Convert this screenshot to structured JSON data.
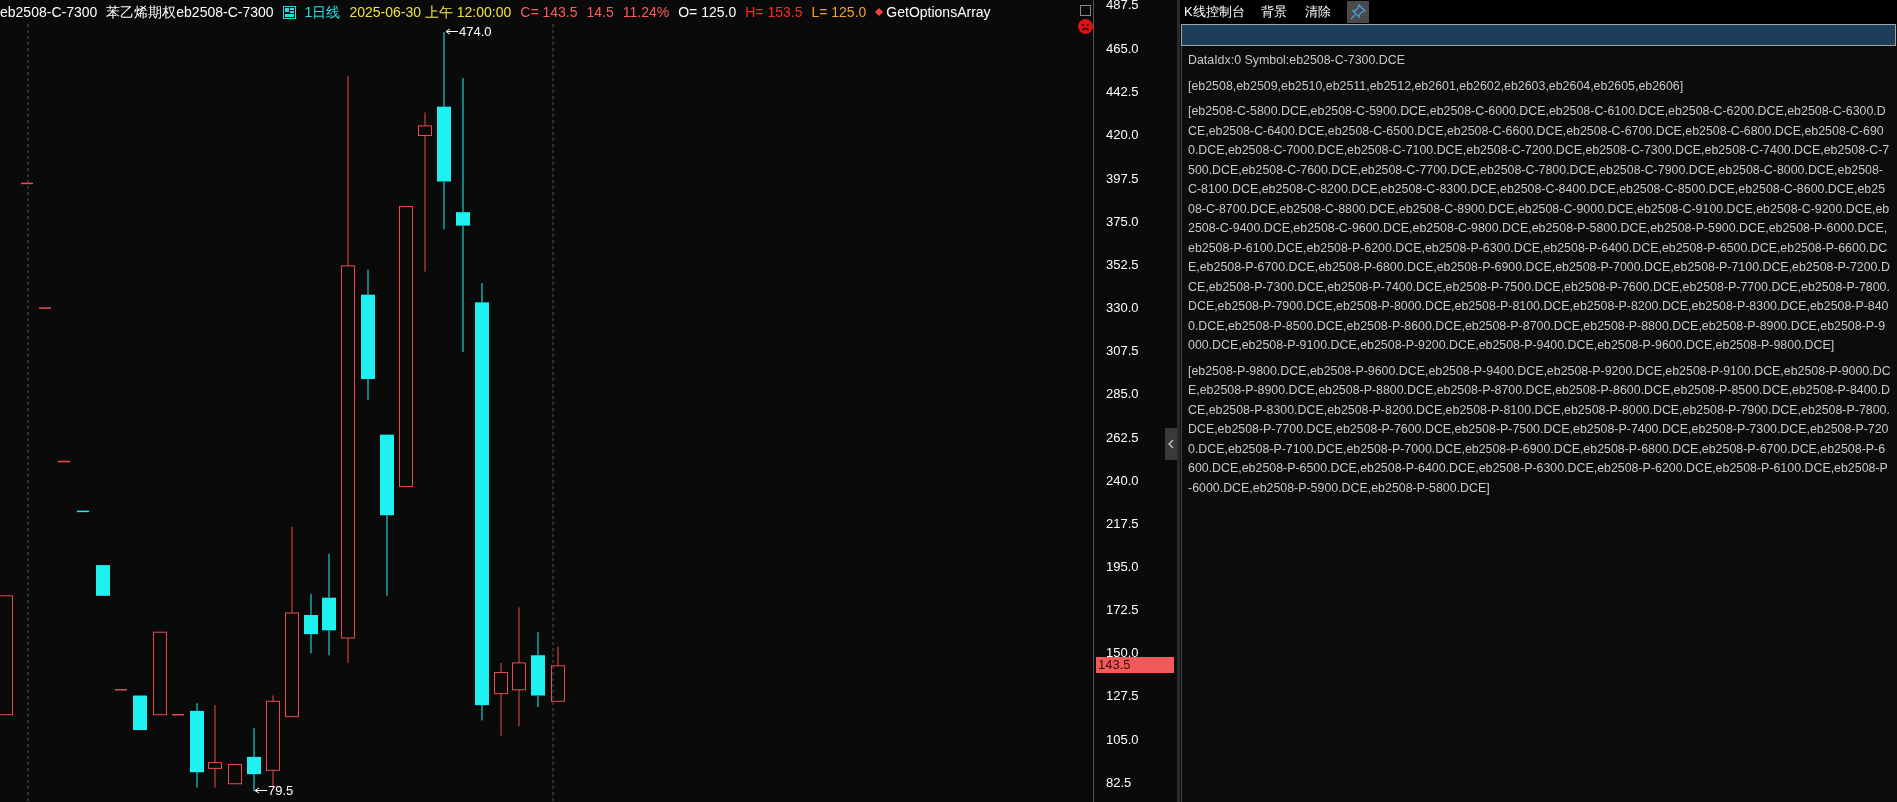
{
  "chart_header": [
    {
      "text": "eb2508-C-7300",
      "color": "#ffffff"
    },
    {
      "text": "苯乙烯期权eb2508-C-7300",
      "color": "#ffffff"
    },
    {
      "text": "1日线",
      "color": "#22e0e0"
    },
    {
      "text": "2025-06-30 上午 12:00:00",
      "color": "#f0e040"
    },
    {
      "text": "C= 143.5",
      "color": "#ff5a5a"
    },
    {
      "text": "14.5",
      "color": "#ff5a5a"
    },
    {
      "text": "11.24%",
      "color": "#ff5a5a"
    },
    {
      "text": "O= 125.0",
      "color": "#ffffff"
    },
    {
      "text": "H= 153.5",
      "color": "#ff2a2a"
    },
    {
      "text": "L= 125.0",
      "color": "#f0a030"
    },
    {
      "text": "GetOptionsArray",
      "color": "#ffffff"
    }
  ],
  "chart_checkbox": {
    "checked": false
  },
  "high_label": "474.0",
  "low_label": "79.5",
  "y_axis": [
    "487.5",
    "465.0",
    "442.5",
    "420.0",
    "397.5",
    "375.0",
    "352.5",
    "330.0",
    "307.5",
    "285.0",
    "262.5",
    "240.0",
    "217.5",
    "195.0",
    "172.5",
    "150.0",
    "127.5",
    "105.0",
    "82.5"
  ],
  "price_tag": "143.5",
  "console": {
    "title": "K线控制台",
    "buttons": [
      "背景",
      "清除"
    ],
    "output_lines": [
      "DataIdx:0 Symbol:eb2508-C-7300.DCE",
      "[eb2508,eb2509,eb2510,eb2511,eb2512,eb2601,eb2602,eb2603,eb2604,eb2605,eb2606]",
      "[eb2508-C-5800.DCE,eb2508-C-5900.DCE,eb2508-C-6000.DCE,eb2508-C-6100.DCE,eb2508-C-6200.DCE,eb2508-C-6300.DCE,eb2508-C-6400.DCE,eb2508-C-6500.DCE,eb2508-C-6600.DCE,eb2508-C-6700.DCE,eb2508-C-6800.DCE,eb2508-C-6900.DCE,eb2508-C-7000.DCE,eb2508-C-7100.DCE,eb2508-C-7200.DCE,eb2508-C-7300.DCE,eb2508-C-7400.DCE,eb2508-C-7500.DCE,eb2508-C-7600.DCE,eb2508-C-7700.DCE,eb2508-C-7800.DCE,eb2508-C-7900.DCE,eb2508-C-8000.DCE,eb2508-C-8100.DCE,eb2508-C-8200.DCE,eb2508-C-8300.DCE,eb2508-C-8400.DCE,eb2508-C-8500.DCE,eb2508-C-8600.DCE,eb2508-C-8700.DCE,eb2508-C-8800.DCE,eb2508-C-8900.DCE,eb2508-C-9000.DCE,eb2508-C-9100.DCE,eb2508-C-9200.DCE,eb2508-C-9400.DCE,eb2508-C-9600.DCE,eb2508-C-9800.DCE,eb2508-P-5800.DCE,eb2508-P-5900.DCE,eb2508-P-6000.DCE,eb2508-P-6100.DCE,eb2508-P-6200.DCE,eb2508-P-6300.DCE,eb2508-P-6400.DCE,eb2508-P-6500.DCE,eb2508-P-6600.DCE,eb2508-P-6700.DCE,eb2508-P-6800.DCE,eb2508-P-6900.DCE,eb2508-P-7000.DCE,eb2508-P-7100.DCE,eb2508-P-7200.DCE,eb2508-P-7300.DCE,eb2508-P-7400.DCE,eb2508-P-7500.DCE,eb2508-P-7600.DCE,eb2508-P-7700.DCE,eb2508-P-7800.DCE,eb2508-P-7900.DCE,eb2508-P-8000.DCE,eb2508-P-8100.DCE,eb2508-P-8200.DCE,eb2508-P-8300.DCE,eb2508-P-8400.DCE,eb2508-P-8500.DCE,eb2508-P-8600.DCE,eb2508-P-8700.DCE,eb2508-P-8800.DCE,eb2508-P-8900.DCE,eb2508-P-9000.DCE,eb2508-P-9100.DCE,eb2508-P-9200.DCE,eb2508-P-9400.DCE,eb2508-P-9600.DCE,eb2508-P-9800.DCE]",
      "[eb2508-P-9800.DCE,eb2508-P-9600.DCE,eb2508-P-9400.DCE,eb2508-P-9200.DCE,eb2508-P-9100.DCE,eb2508-P-9000.DCE,eb2508-P-8900.DCE,eb2508-P-8800.DCE,eb2508-P-8700.DCE,eb2508-P-8600.DCE,eb2508-P-8500.DCE,eb2508-P-8400.DCE,eb2508-P-8300.DCE,eb2508-P-8200.DCE,eb2508-P-8100.DCE,eb2508-P-8000.DCE,eb2508-P-7900.DCE,eb2508-P-7800.DCE,eb2508-P-7700.DCE,eb2508-P-7600.DCE,eb2508-P-7500.DCE,eb2508-P-7400.DCE,eb2508-P-7300.DCE,eb2508-P-7200.DCE,eb2508-P-7100.DCE,eb2508-P-7000.DCE,eb2508-P-6900.DCE,eb2508-P-6800.DCE,eb2508-P-6700.DCE,eb2508-P-6600.DCE,eb2508-P-6500.DCE,eb2508-P-6400.DCE,eb2508-P-6300.DCE,eb2508-P-6200.DCE,eb2508-P-6100.DCE,eb2508-P-6000.DCE,eb2508-P-5900.DCE,eb2508-P-5800.DCE]"
    ]
  }
}
